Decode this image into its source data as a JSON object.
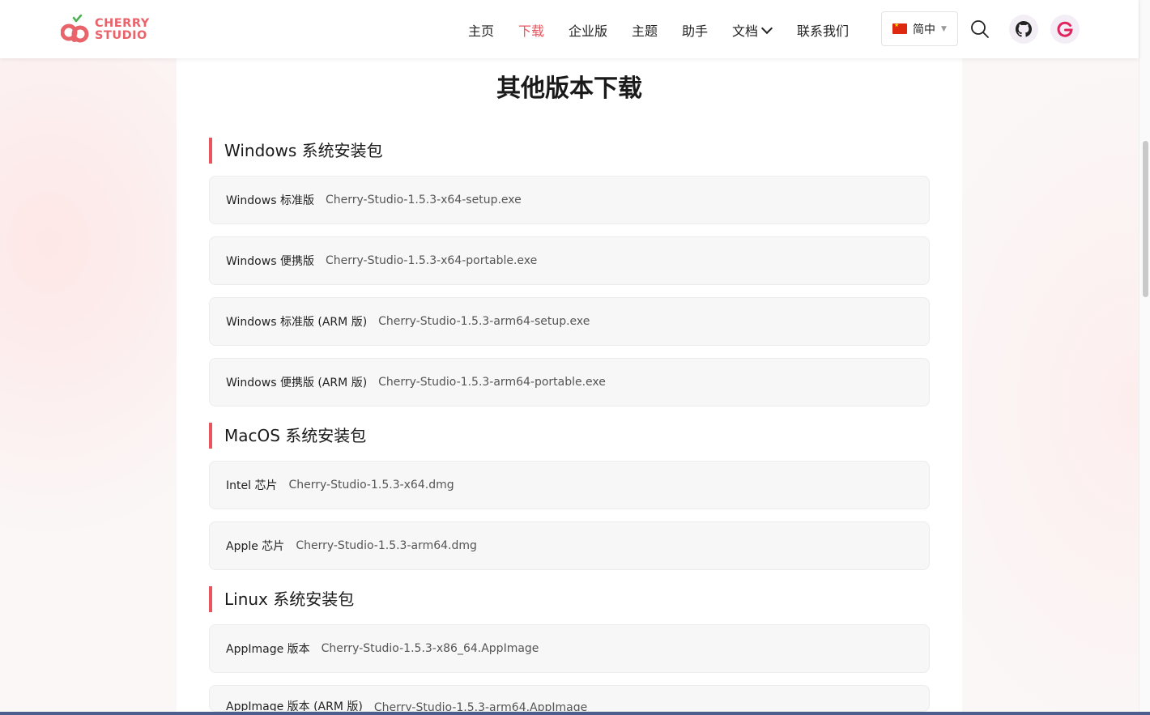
{
  "logo": {
    "line1": "CHERRY",
    "line2": "STUDIO"
  },
  "nav": {
    "items": [
      {
        "label": "主页"
      },
      {
        "label": "下载"
      },
      {
        "label": "企业版"
      },
      {
        "label": "主题"
      },
      {
        "label": "助手"
      },
      {
        "label": "文档"
      },
      {
        "label": "联系我们"
      }
    ],
    "active": "下载"
  },
  "language": {
    "label": "简中"
  },
  "icons": {
    "search": "search-icon",
    "github": "github-icon",
    "g": "g-logo-icon"
  },
  "colors": {
    "accent": "#e9545e",
    "logo": "#e9636b"
  },
  "page": {
    "title": "其他版本下载"
  },
  "sections": {
    "windows": {
      "title": "Windows 系统安装包",
      "items": [
        {
          "label": "Windows 标准版",
          "file": "Cherry-Studio-1.5.3-x64-setup.exe"
        },
        {
          "label": "Windows 便携版",
          "file": "Cherry-Studio-1.5.3-x64-portable.exe"
        },
        {
          "label": "Windows 标准版 (ARM 版)",
          "file": "Cherry-Studio-1.5.3-arm64-setup.exe"
        },
        {
          "label": "Windows 便携版 (ARM 版)",
          "file": "Cherry-Studio-1.5.3-arm64-portable.exe"
        }
      ]
    },
    "macos": {
      "title": "MacOS 系统安装包",
      "items": [
        {
          "label": "Intel 芯片",
          "file": "Cherry-Studio-1.5.3-x64.dmg"
        },
        {
          "label": "Apple 芯片",
          "file": "Cherry-Studio-1.5.3-arm64.dmg"
        }
      ]
    },
    "linux": {
      "title": "Linux 系统安装包",
      "items": [
        {
          "label": "AppImage 版本",
          "file": "Cherry-Studio-1.5.3-x86_64.AppImage"
        },
        {
          "label": "AppImage 版本 (ARM 版)",
          "file": "Cherry-Studio-1.5.3-arm64.AppImage"
        }
      ]
    }
  }
}
